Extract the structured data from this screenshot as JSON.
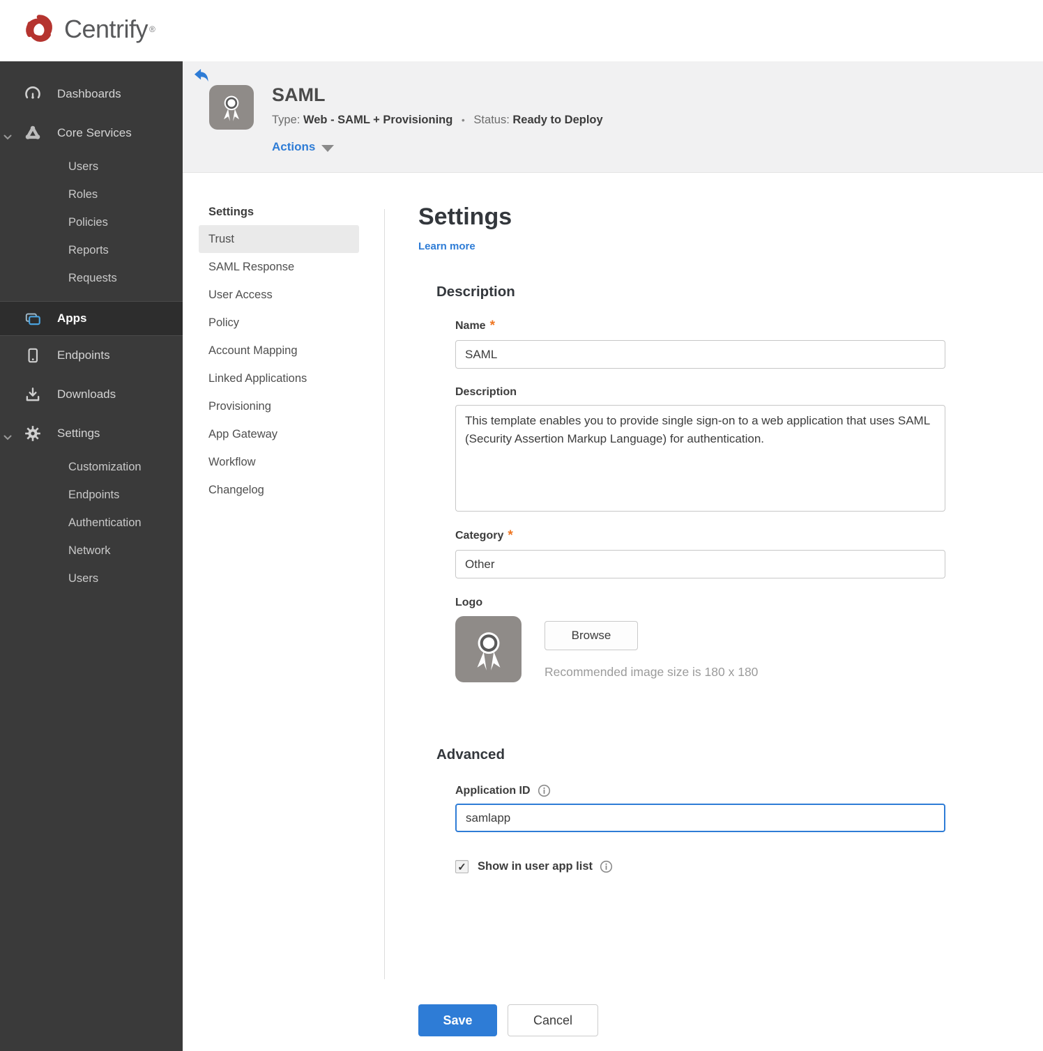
{
  "brand": {
    "name": "Centrify",
    "registered": "®"
  },
  "sidebar": {
    "items": [
      {
        "label": "Dashboards"
      },
      {
        "label": "Core Services"
      },
      {
        "label": "Users"
      },
      {
        "label": "Roles"
      },
      {
        "label": "Policies"
      },
      {
        "label": "Reports"
      },
      {
        "label": "Requests"
      },
      {
        "label": "Apps"
      },
      {
        "label": "Endpoints"
      },
      {
        "label": "Downloads"
      },
      {
        "label": "Settings"
      },
      {
        "label": "Customization"
      },
      {
        "label": "Endpoints"
      },
      {
        "label": "Authentication"
      },
      {
        "label": "Network"
      },
      {
        "label": "Users"
      }
    ]
  },
  "app_header": {
    "title": "SAML",
    "type_label": "Type:",
    "type_value": "Web - SAML + Provisioning",
    "separator": "•",
    "status_label": "Status:",
    "status_value": "Ready to Deploy",
    "actions_label": "Actions"
  },
  "subnav": {
    "title": "Settings",
    "items": [
      {
        "label": "Trust",
        "selected": true
      },
      {
        "label": "SAML Response"
      },
      {
        "label": "User Access"
      },
      {
        "label": "Policy"
      },
      {
        "label": "Account Mapping"
      },
      {
        "label": "Linked Applications"
      },
      {
        "label": "Provisioning"
      },
      {
        "label": "App Gateway"
      },
      {
        "label": "Workflow"
      },
      {
        "label": "Changelog"
      }
    ]
  },
  "main": {
    "title": "Settings",
    "learn_more": "Learn more",
    "required_marker": "*",
    "description_section": {
      "heading": "Description",
      "name_label": "Name",
      "name_value": "SAML",
      "description_label": "Description",
      "description_value": "This template enables you to provide single sign-on to a web application that uses SAML (Security Assertion Markup Language) for authentication.",
      "category_label": "Category",
      "category_value": "Other",
      "logo_label": "Logo",
      "browse_label": "Browse",
      "logo_hint": "Recommended image size is 180 x 180"
    },
    "advanced_section": {
      "heading": "Advanced",
      "app_id_label": "Application ID",
      "app_id_value": "samlapp",
      "show_in_app_list_label": "Show in user app list",
      "checkbox_checked": true,
      "check_glyph": "✓"
    },
    "footer": {
      "save_label": "Save",
      "cancel_label": "Cancel"
    }
  },
  "colors": {
    "accent_blue": "#2e7cd6",
    "status_red": "#a32622",
    "required_orange": "#ee7623",
    "apps_icon_blue": "#4aa3df",
    "sidebar_bg": "#3a3a3a",
    "header_bg": "#f1f1f2"
  }
}
